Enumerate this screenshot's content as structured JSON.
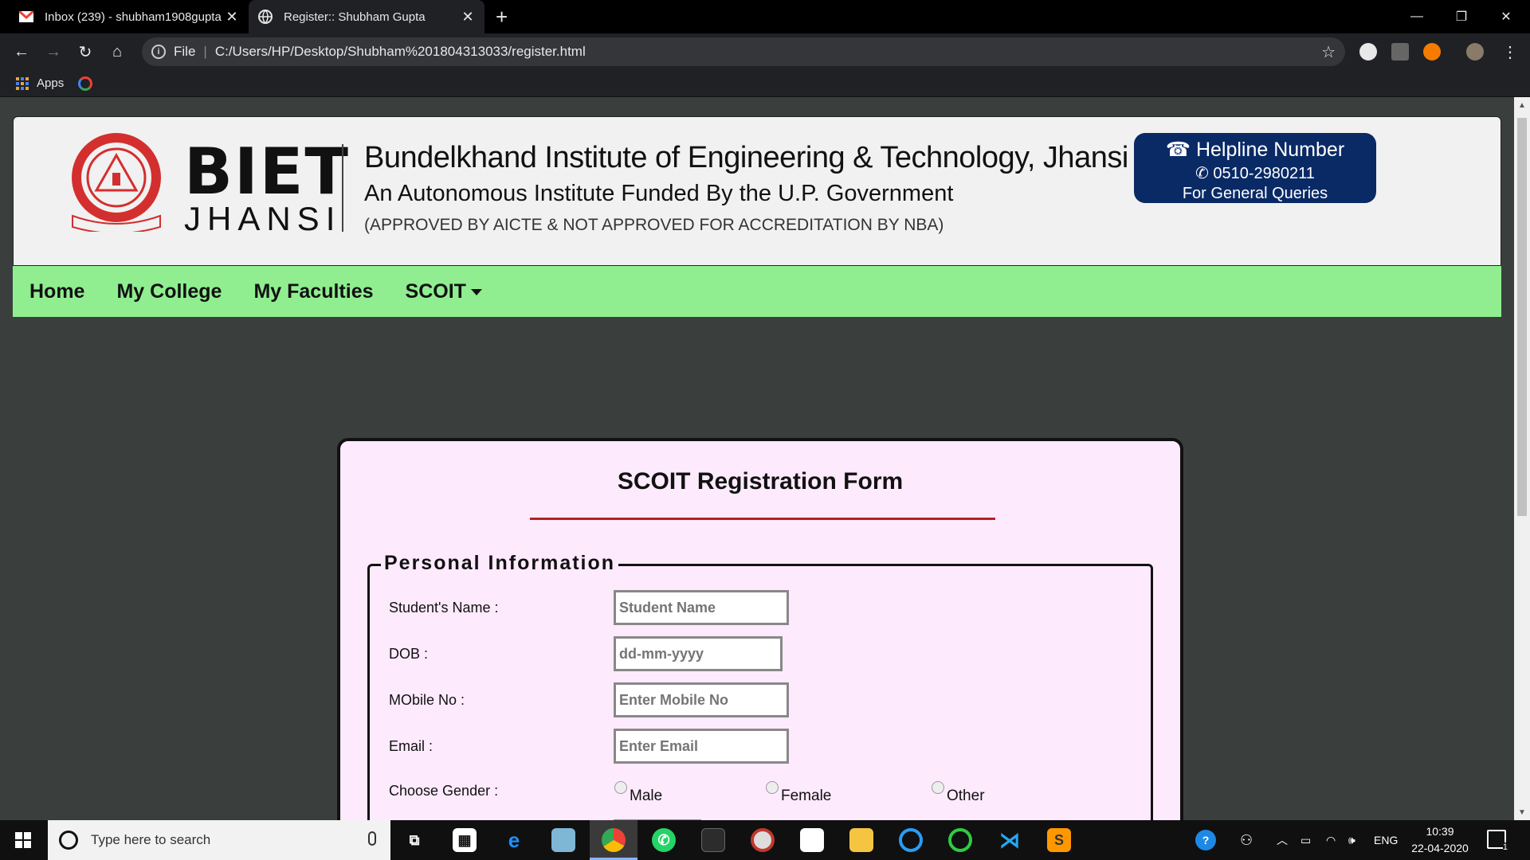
{
  "browser": {
    "tabs": [
      {
        "label": "Inbox (239) - shubham1908gupta",
        "icon": "gmail-icon",
        "active": false
      },
      {
        "label": "Register:: Shubham Gupta",
        "icon": "globe-icon",
        "active": true
      }
    ],
    "new_tab": "+",
    "address_scheme": "File",
    "address_url": "C:/Users/HP/Desktop/Shubham%201804313033/register.html",
    "bookmarks": {
      "apps_label": "Apps"
    }
  },
  "site": {
    "logo_big": "BIET",
    "logo_small": "JHANSI",
    "institute_name": "Bundelkhand Institute of Engineering & Technology, Jhansi",
    "institute_subtitle": "An Autonomous Institute Funded By the U.P. Government",
    "institute_approval": "(APPROVED BY AICTE  & NOT APPROVED FOR ACCREDITATION BY NBA)",
    "helpline": {
      "title": "☎ Helpline Number",
      "number": "✆ 0510-2980211",
      "note": "For General Queries"
    },
    "nav": [
      {
        "label": "Home"
      },
      {
        "label": "My College"
      },
      {
        "label": "My Faculties"
      },
      {
        "label": "SCOIT"
      }
    ]
  },
  "form": {
    "title": "SCOIT Registration Form",
    "legend": "Personal Information",
    "fields": {
      "name": {
        "label": "Student's Name :",
        "placeholder": "Student Name"
      },
      "dob": {
        "label": "DOB :",
        "placeholder": "dd-mm-yyyy"
      },
      "mobile": {
        "label": "MObile No :",
        "placeholder": "Enter Mobile No"
      },
      "email": {
        "label": "Email :",
        "placeholder": "Enter Email"
      },
      "gender": {
        "label": "Choose Gender :",
        "options": [
          "Male",
          "Female",
          "Other"
        ]
      }
    }
  },
  "taskbar": {
    "search_placeholder": "Type here to search",
    "language": "ENG",
    "time": "10:39",
    "date": "22-04-2020",
    "notification_count": "1"
  },
  "colors": {
    "nav_bg": "#90ee90",
    "helpline_bg": "#0a2a66",
    "form_bg": "#fdeafd",
    "page_bg": "#3a3f3e",
    "title_rule": "#b22222"
  }
}
